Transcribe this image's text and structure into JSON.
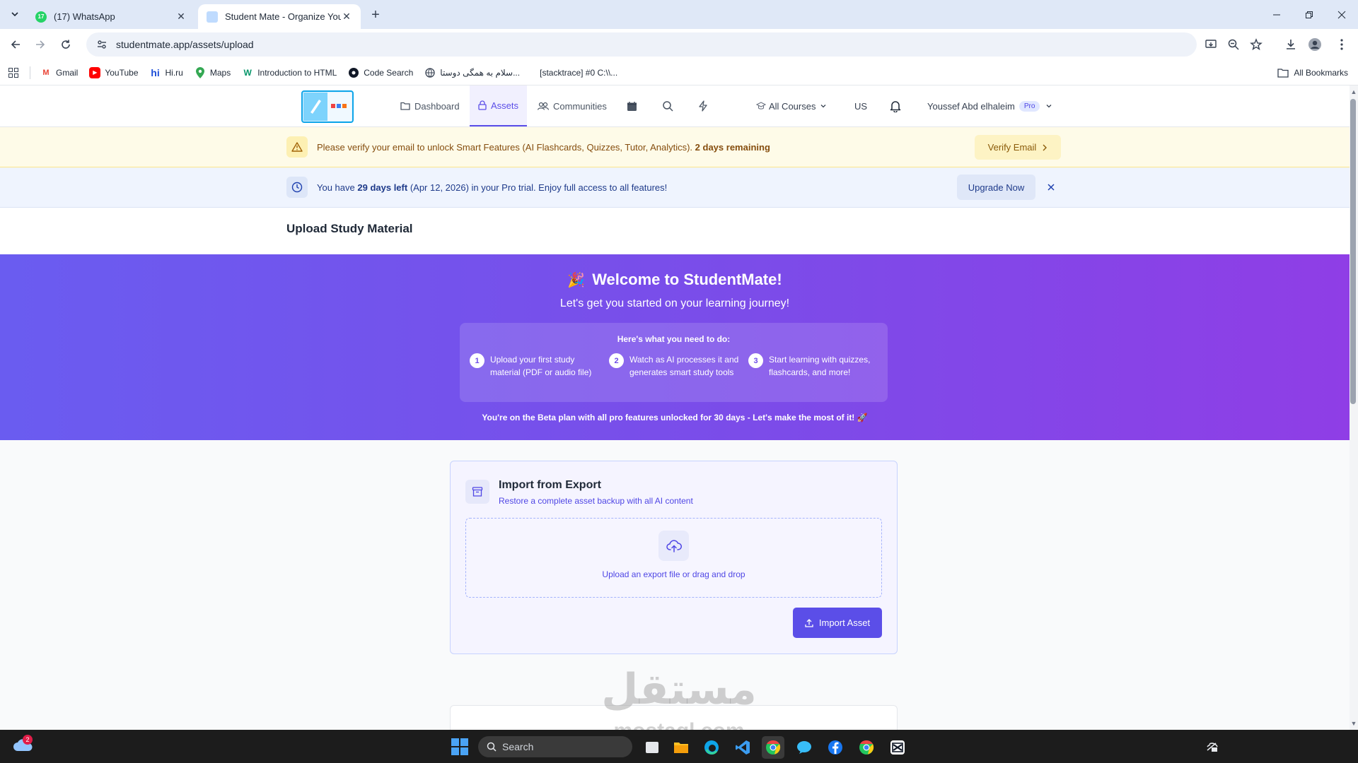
{
  "browser": {
    "tabs": [
      {
        "title": "(17) WhatsApp",
        "badge": "17",
        "active": false
      },
      {
        "title": "Student Mate - Organize Your E",
        "active": true
      }
    ],
    "url": "studentmate.app/assets/upload",
    "bookmarks": [
      {
        "label": "Gmail",
        "icon": "gmail-icon"
      },
      {
        "label": "YouTube",
        "icon": "youtube-icon"
      },
      {
        "label": "Hi.ru",
        "icon": "hiru-icon"
      },
      {
        "label": "Maps",
        "icon": "maps-icon"
      },
      {
        "label": "Introduction to HTML",
        "icon": "w3-icon"
      },
      {
        "label": "Code Search",
        "icon": "code-search-icon"
      },
      {
        "label": "سلام به همگی دوستا...",
        "icon": "globe-icon"
      },
      {
        "label": "[stacktrace] #0 C:\\\\...",
        "icon": "blank-icon"
      }
    ],
    "all_bookmarks_label": "All Bookmarks"
  },
  "app": {
    "nav": {
      "dashboard": "Dashboard",
      "assets": "Assets",
      "communities": "Communities",
      "all_courses": "All Courses",
      "locale": "US",
      "user_name": "Youssef Abd elhaleim",
      "plan_badge": "Pro"
    },
    "verify_banner": {
      "text": "Please verify your email to unlock Smart Features (AI Flashcards, Quizzes, Tutor, Analytics).",
      "days": "2 days remaining",
      "button": "Verify Email"
    },
    "trial_banner": {
      "prefix": "You have",
      "days_left": "29 days left",
      "suffix": "(Apr 12, 2026) in your Pro trial. Enjoy full access to all features!",
      "button": "Upgrade Now"
    },
    "page_title": "Upload Study Material",
    "welcome": {
      "title": "Welcome to StudentMate!",
      "subtitle": "Let's get you started on your learning journey!",
      "steps_heading": "Here's what you need to do:",
      "steps": [
        {
          "num": "1",
          "text": "Upload your first study material (PDF or audio file)"
        },
        {
          "num": "2",
          "text": "Watch as AI processes it and generates smart study tools"
        },
        {
          "num": "3",
          "text": "Start learning with quizzes, flashcards, and more!"
        }
      ],
      "footer": "You're on the Beta plan with all pro features unlocked for 30 days - Let's make the most of it! 🚀"
    },
    "import": {
      "title": "Import from Export",
      "subtitle": "Restore a complete asset backup with all AI content",
      "dropzone_text": "Upload an export file or drag and drop",
      "button": "Import Asset"
    }
  },
  "watermark": {
    "arabic": "مستقل",
    "latin": "mostaql.com"
  },
  "taskbar": {
    "search_placeholder": "Search",
    "weather_badge": "2"
  },
  "colors": {
    "primary": "#5b4ee8",
    "hero_start": "#6a5cf0",
    "hero_end": "#8f3ee6",
    "warning_bg": "#fefbe8",
    "trial_bg": "#eff4fe"
  }
}
